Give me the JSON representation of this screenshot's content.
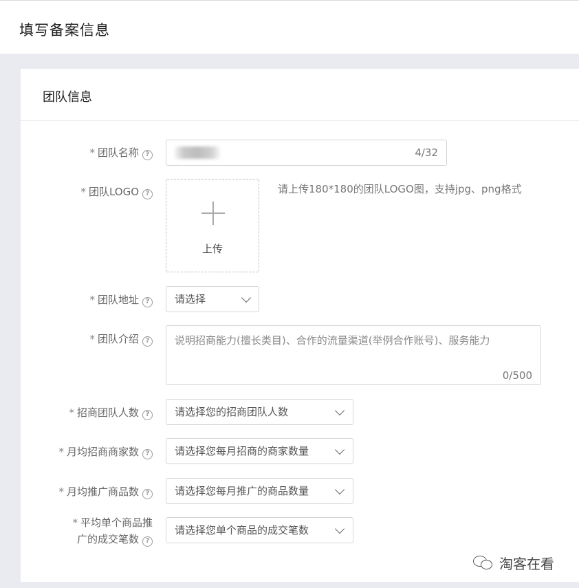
{
  "page": {
    "title": "填写备案信息"
  },
  "section": {
    "title": "团队信息"
  },
  "fields": {
    "team_name": {
      "required": "*",
      "label": "团队名称",
      "counter": "4/32"
    },
    "team_logo": {
      "required": "*",
      "label": "团队LOGO",
      "upload_label": "上传",
      "hint": "请上传180*180的团队LOGO图，支持jpg、png格式"
    },
    "team_address": {
      "required": "*",
      "label": "团队地址",
      "value": "请选择"
    },
    "team_intro": {
      "required": "*",
      "label": "团队介绍",
      "placeholder": "说明招商能力(擅长类目)、合作的流量渠道(举例合作账号)、服务能力",
      "counter": "0/500"
    },
    "team_size": {
      "required": "*",
      "label": "招商团队人数",
      "value": "请选择您的招商团队人数"
    },
    "monthly_merchants": {
      "required": "*",
      "label": "月均招商商家数",
      "value": "请选择您每月招商的商家数量"
    },
    "monthly_products": {
      "required": "*",
      "label": "月均推广商品数",
      "value": "请选择您每月推广的商品数量"
    },
    "avg_deals": {
      "required": "*",
      "label_line1": "平均单个商品推",
      "label_line2": "广的成交笔数",
      "value": "请选择您单个商品的成交笔数"
    }
  },
  "help_icon": "?",
  "watermark": {
    "text": "淘客在看",
    "icon": "wechat-icon"
  }
}
